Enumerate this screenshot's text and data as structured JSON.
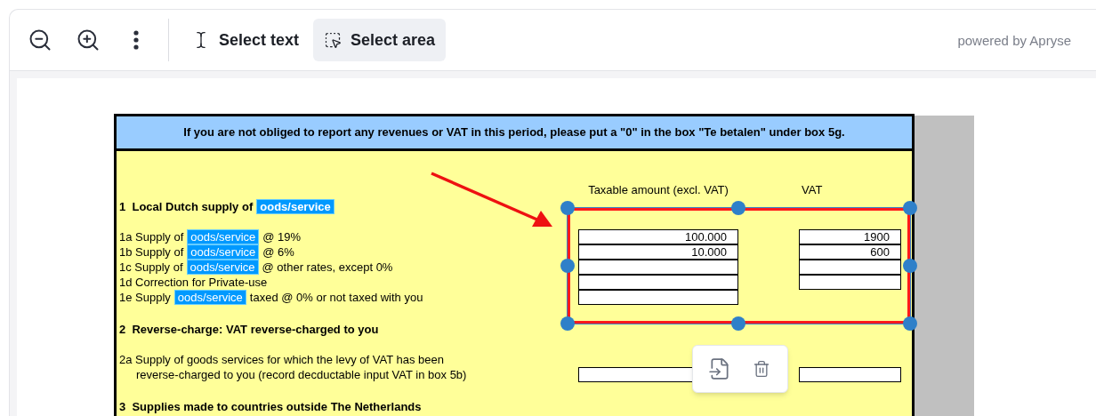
{
  "toolbar": {
    "icon_buttons": [
      {
        "kind": "zoom-out"
      },
      {
        "kind": "zoom-in"
      },
      {
        "kind": "more"
      }
    ],
    "tools": [
      {
        "kind": "text",
        "label": "Select text",
        "selected": false
      },
      {
        "kind": "area",
        "label": "Select area",
        "selected": true
      }
    ],
    "credit": "powered by Apryse"
  },
  "form": {
    "notice": "If you are not obliged to report any revenues or VAT in this period, please put a \"0\" in the box \"Te betalen\" under box 5g.",
    "columns": [
      "Taxable amount (excl. VAT)",
      "VAT"
    ],
    "sections": [
      {
        "title": "1  Local Dutch supply of",
        "title_tag": "oods/service",
        "items": [
          {
            "code": "1a",
            "before": "Supply of",
            "tag": "oods/service",
            "after": "@ 19%",
            "taxable_field": true,
            "taxable_value": "100.000",
            "vat_field": true,
            "vat_value": "1900"
          },
          {
            "code": "1b",
            "before": "Supply of",
            "tag": "oods/service",
            "after": "@ 6%",
            "taxable_field": true,
            "taxable_value": "10.000",
            "vat_field": true,
            "vat_value": "600"
          },
          {
            "code": "1c",
            "before": "Supply of",
            "tag": "oods/service",
            "after": "@ other rates, except 0%",
            "taxable_field": true,
            "vat_field": true
          },
          {
            "code": "1d",
            "before": "Correction for Private-use",
            "taxable_field": true,
            "vat_field": true
          },
          {
            "code": "1e",
            "before": "Supply",
            "tag": "oods/service",
            "after": "taxed @ 0% or not taxed with you",
            "taxable_field": true,
            "vat_field": false
          }
        ]
      },
      {
        "title": "2  Reverse-charge: VAT reverse-charged to you",
        "items": [
          {
            "code": "2a",
            "before": "Supply of goods services for which the levy of VAT has been",
            "continuation": "reverse-charged to you (record decductable input VAT in box 5b)",
            "taxable_field": true,
            "vat_field": true
          }
        ]
      },
      {
        "title": "3  Supplies made to countries outside The Netherlands"
      }
    ]
  },
  "selection": {
    "selected": true,
    "actions": [
      {
        "kind": "export"
      },
      {
        "kind": "delete"
      }
    ]
  }
}
